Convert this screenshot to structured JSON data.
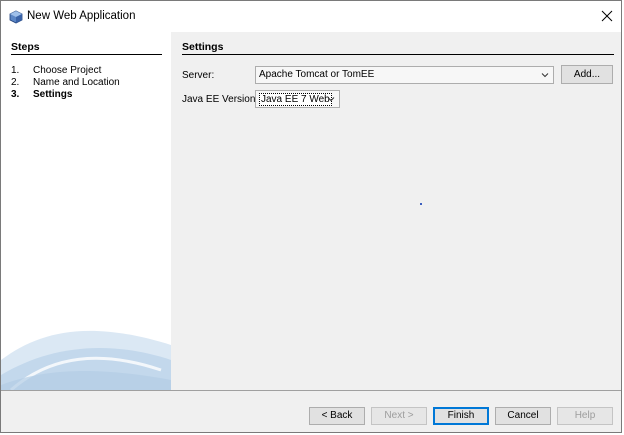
{
  "window": {
    "title": "New Web Application",
    "title_icon": "netbeans-cube-icon",
    "close_icon": "close-icon"
  },
  "steps": {
    "title": "Steps",
    "items": [
      {
        "num": "1.",
        "label": "Choose Project",
        "current": false
      },
      {
        "num": "2.",
        "label": "Name and Location",
        "current": false
      },
      {
        "num": "3.",
        "label": "Settings",
        "current": true
      }
    ]
  },
  "settings": {
    "title": "Settings",
    "server_label": "Server:",
    "server_value": "Apache Tomcat or TomEE",
    "add_button": "Add...",
    "javaee_label": "Java EE Version:",
    "javaee_value": "Java EE 7 Web"
  },
  "footer": {
    "back": "< Back",
    "next": "Next >",
    "finish": "Finish",
    "cancel": "Cancel",
    "help": "Help"
  },
  "colors": {
    "accent": "#0078d7",
    "panel": "#f0f0f0",
    "sidebar": "#ffffff",
    "swoosh": "#a9c7e3"
  }
}
